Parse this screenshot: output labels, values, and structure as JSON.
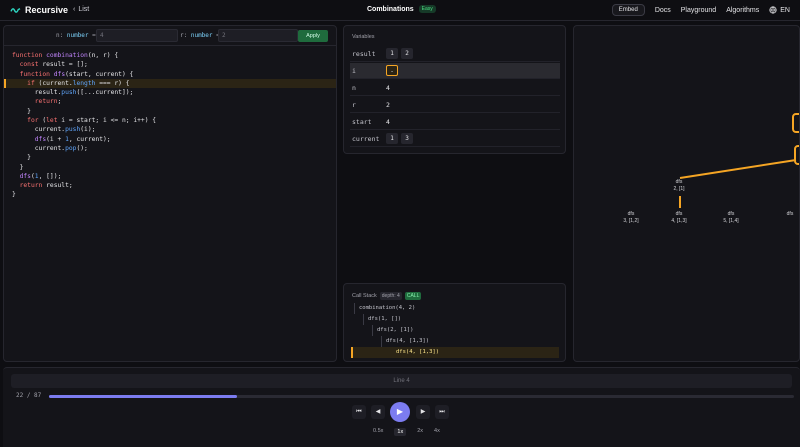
{
  "topbar": {
    "brand": "Recursive",
    "back_label": "List",
    "problem_title": "Combinations",
    "difficulty": "Easy",
    "embed_label": "Embed",
    "nav": [
      "Docs",
      "Playground",
      "Algorithms"
    ],
    "lang": "EN"
  },
  "params": {
    "n_label": "n:",
    "n_type": "number",
    "n_value": "4",
    "r_label": "r:",
    "r_type": "number",
    "r_value": "2",
    "apply_label": "Apply"
  },
  "code": {
    "lines": [
      "function combination(n, r) {",
      "  const result = [];",
      "  function dfs(start, current) {",
      "    if (current.length === r) {",
      "      result.push([...current]);",
      "      return;",
      "    }",
      "    for (let i = start; i <= n; i++) {",
      "      current.push(i);",
      "      dfs(i + 1, current);",
      "      current.pop();",
      "    }",
      "  }",
      "  dfs(1, []);",
      "  return result;",
      "}"
    ],
    "highlight_line": 4
  },
  "variables": {
    "title": "Variables",
    "rows": [
      {
        "name": "result",
        "chips": [
          "1",
          "2"
        ]
      },
      {
        "name": "i",
        "chips": [
          "-"
        ]
      },
      {
        "name": "n",
        "value": "4"
      },
      {
        "name": "r",
        "value": "2"
      },
      {
        "name": "start",
        "value": "4"
      },
      {
        "name": "current",
        "chips": [
          "1",
          "3"
        ]
      }
    ]
  },
  "call_stack": {
    "title": "Call Stack",
    "depth_label": "depth: 4",
    "state": "CALL",
    "frames": [
      "combination(4, 2)",
      "dfs(1, [])",
      "dfs(2, [1])",
      "dfs(4, [1,3])",
      "dfs(4, [1,3])"
    ]
  },
  "tree": {
    "nodes": [
      {
        "label": "dfs",
        "args": "2, [1]",
        "state": "on"
      },
      {
        "label": "dfs",
        "args": "3, [1,2]",
        "state": "off"
      },
      {
        "label": "dfs",
        "args": "4, [1,3]",
        "state": "on"
      },
      {
        "label": "dfs",
        "args": "5, [1,4]",
        "state": "off"
      },
      {
        "label": "dfs",
        "args": "",
        "state": "off"
      }
    ]
  },
  "player": {
    "line_info": "Line 4",
    "step_current": 22,
    "step_total": 87,
    "counter": "22 / 87",
    "speeds": [
      "0.5x",
      "1x",
      "2x",
      "4x"
    ],
    "selected_speed": "1x"
  },
  "colors": {
    "accent": "#7c7cf0",
    "highlight": "#f5a524",
    "keyword": "#f87171",
    "function": "#c084fc"
  }
}
